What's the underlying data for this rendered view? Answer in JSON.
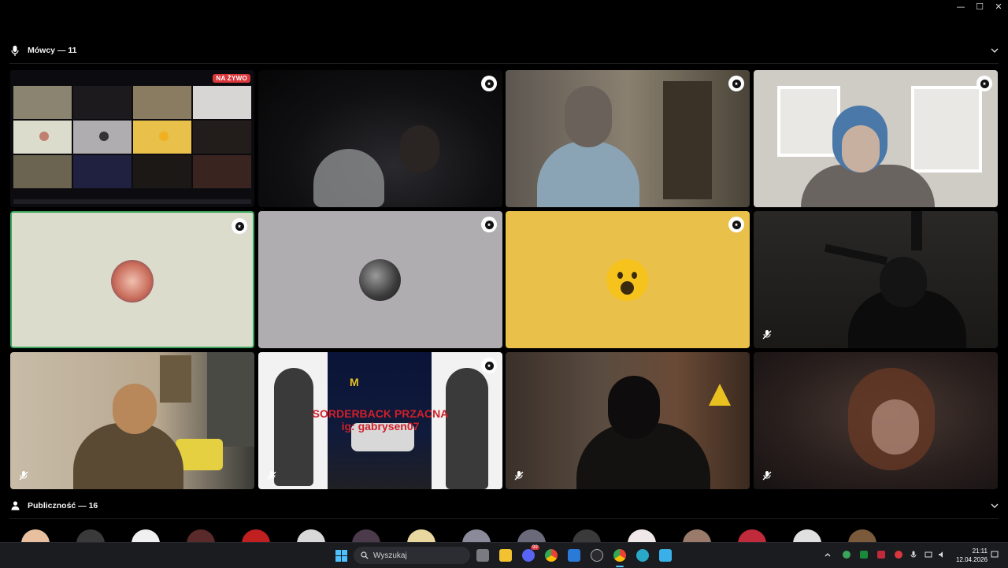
{
  "window": {
    "minimize": "—",
    "maximize": "☐",
    "close": "✕"
  },
  "speakers": {
    "title": "Mówcy — 11"
  },
  "audience": {
    "title": "Publiczność — 16"
  },
  "stream": {
    "live_label": "NA ŻYWO"
  },
  "tile_overlay": {
    "line1": "SORDERBACK PRZACNA",
    "line2": "ig: gabrysen07"
  },
  "taskbar": {
    "search_placeholder": "Wyszukaj",
    "time": "21:11",
    "date": "12.04.2026",
    "notify_count": "99"
  },
  "colors": {
    "bg": "#000000",
    "tile_beige": "#dcdccc",
    "tile_grey": "#b0adb0",
    "tile_yellow": "#e8c04a",
    "speaking_ring": "#3ba55c",
    "live_red": "#da373c"
  },
  "icons": {
    "speakers_section": "microphone-icon",
    "audience_section": "people-icon",
    "collapse": "chevron-down-icon",
    "moderator": "badge-icon",
    "muted": "mic-off-icon"
  }
}
